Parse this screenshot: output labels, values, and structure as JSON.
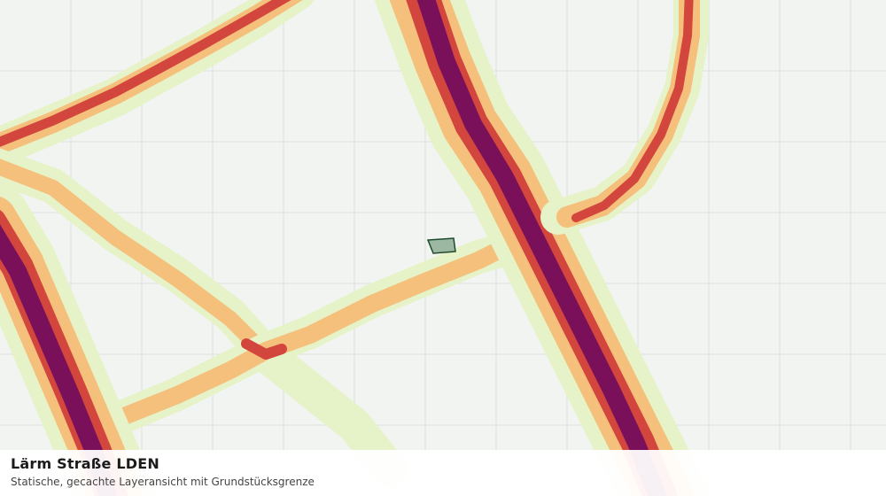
{
  "caption": {
    "title": "Lärm Straße LDEN",
    "subtitle": "Statische, gecachte Layeransicht mit Grundstücksgrenze"
  },
  "colors": {
    "background": "#f2f4f2",
    "grid": "#dde0dd",
    "noise_lowest": "#e6f2c8",
    "noise_low": "#f4c07c",
    "noise_medium": "#d2463e",
    "noise_high": "#7a0f5a",
    "parcel_fill": "#9db8a2",
    "parcel_stroke": "#1f4a2c"
  }
}
